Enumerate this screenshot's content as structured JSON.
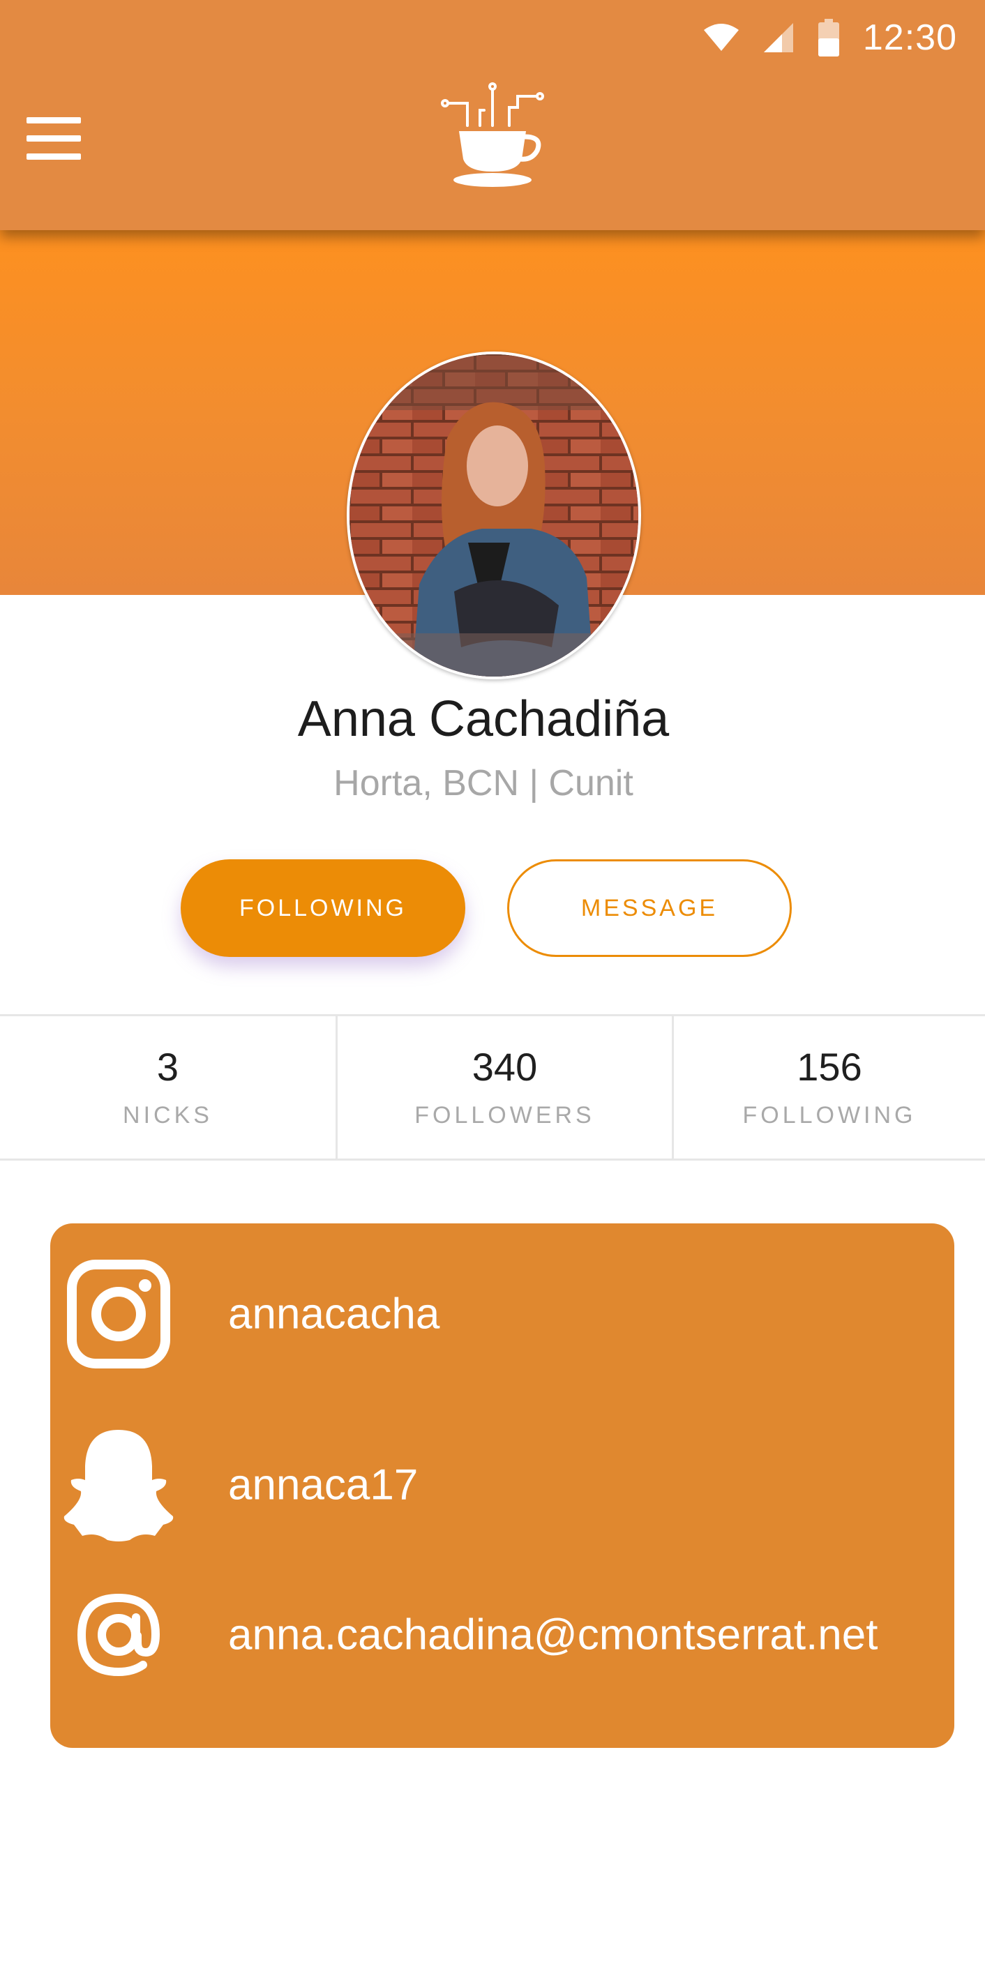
{
  "status_bar": {
    "time": "12:30",
    "icons": [
      "wifi-icon",
      "signal-icon",
      "battery-icon"
    ]
  },
  "app_bar": {
    "menu_icon": "hamburger-menu-icon",
    "logo_icon": "coffee-cup-circuit-logo"
  },
  "profile": {
    "name": "Anna Cachadiña",
    "location": "Horta, BCN | Cunit"
  },
  "actions": {
    "following_label": "FOLLOWING",
    "message_label": "MESSAGE"
  },
  "stats": [
    {
      "value": "3",
      "label": "NICKS"
    },
    {
      "value": "340",
      "label": "FOLLOWERS"
    },
    {
      "value": "156",
      "label": "FOLLOWING"
    }
  ],
  "social": {
    "instagram": {
      "icon": "instagram-icon",
      "handle": "annacacha"
    },
    "snapchat": {
      "icon": "snapchat-icon",
      "handle": "annaca17"
    },
    "email": {
      "icon": "at-sign-icon",
      "address": "anna.cachadina@cmontserrat.net"
    }
  },
  "colors": {
    "app_bar": "#e38a42",
    "cover": "#f28d2f",
    "accent": "#ec8c06",
    "card": "#e0882f",
    "text_primary": "#1d1d1d",
    "text_muted": "#a7a7a7"
  }
}
